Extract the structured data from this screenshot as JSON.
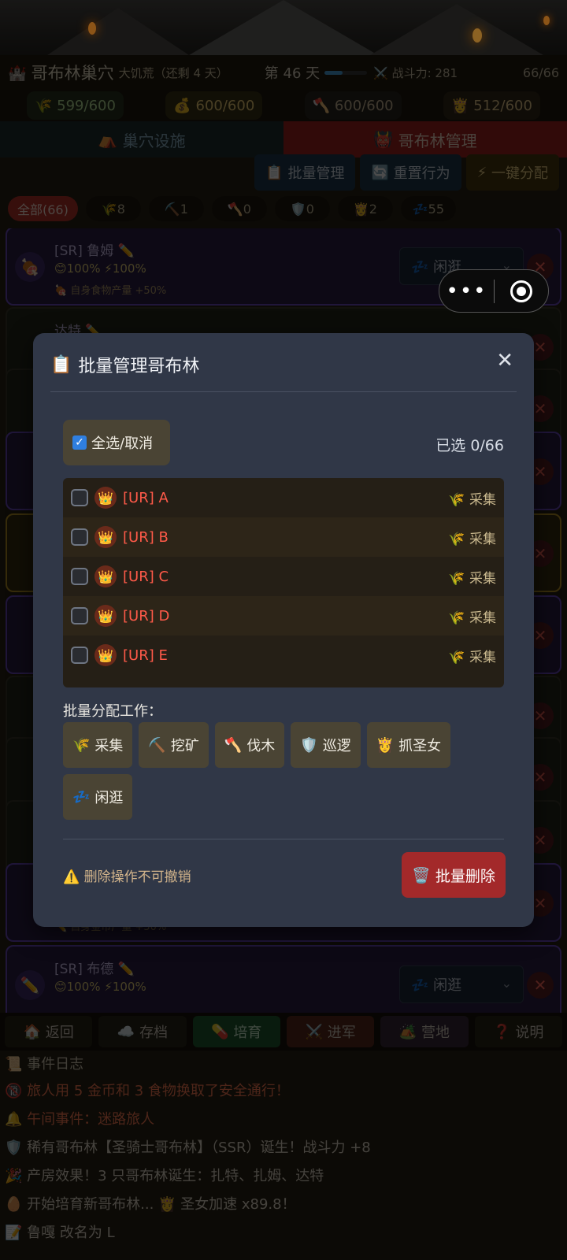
{
  "header": {
    "title": "哥布林巢穴",
    "event": "大饥荒（还剩 4 天）",
    "day": "第 46 天",
    "day_progress": 0.42,
    "power": "战斗力: 281",
    "population": "66/66"
  },
  "resources": [
    {
      "icon": "🌾",
      "value": "599/600"
    },
    {
      "icon": "💰",
      "value": "600/600"
    },
    {
      "icon": "🪓",
      "value": "600/600"
    },
    {
      "icon": "👸",
      "value": "512/600"
    }
  ],
  "tabs": [
    {
      "icon": "⛺",
      "label": "巢穴设施"
    },
    {
      "icon": "👹",
      "label": "哥布林管理"
    }
  ],
  "actions": [
    {
      "icon": "📋",
      "label": "批量管理"
    },
    {
      "icon": "🔄",
      "label": "重置行为"
    },
    {
      "icon": "⚡",
      "label": "一键分配"
    }
  ],
  "filters": [
    {
      "label": "全部(66)"
    },
    {
      "label": "🌾8"
    },
    {
      "label": "⛏️1"
    },
    {
      "label": "🪓0"
    },
    {
      "label": "🛡️0"
    },
    {
      "label": "👸2"
    },
    {
      "label": "💤55"
    }
  ],
  "cards": [
    {
      "name": "[SR] 鲁姆 ✏️",
      "stats": "😊100% ⚡100%",
      "bonus": "🍖 自身食物产量 +50%",
      "job": "💤 闲逛",
      "avatar": "🍖"
    },
    {
      "name": "[SR] 布德 ✏️",
      "stats": "😊100% ⚡100%",
      "bonus": "",
      "job": "💤 闲逛",
      "avatar": "✏️"
    }
  ],
  "background_partial": {
    "card2_name": "达特 ✏️",
    "card_bonus_gold": "✏️ 自身金币产量 +50%"
  },
  "bottom_nav": [
    {
      "icon": "🏠",
      "label": "返回"
    },
    {
      "icon": "☁️",
      "label": "存档"
    },
    {
      "icon": "💊",
      "label": "培育"
    },
    {
      "icon": "⚔️",
      "label": "进军"
    },
    {
      "icon": "🏕️",
      "label": "营地"
    },
    {
      "icon": "❓",
      "label": "说明"
    }
  ],
  "log": {
    "title": "📜 事件日志",
    "entries": [
      {
        "text": "🔞 旅人用 5 金币和 3 食物换取了安全通行！",
        "tone": "orange"
      },
      {
        "text": "🔔 午间事件：迷路旅人",
        "tone": "orange"
      },
      {
        "text": "🛡️ 稀有哥布林【圣骑士哥布林】（SSR）诞生！战斗力 +8",
        "tone": "white"
      },
      {
        "text": "🎉 产房效果！3 只哥布林诞生：扎特、扎姆、达特",
        "tone": "white"
      },
      {
        "text": "🥚 开始培育新哥布林... 👸 圣女加速 x89.8！",
        "tone": "white"
      },
      {
        "text": "📝 鲁嘎 改名为 L",
        "tone": "white"
      }
    ]
  },
  "modal": {
    "title": "批量管理哥布林",
    "title_icon": "📋",
    "close": "✕",
    "select_all": "全选/取消",
    "selected_count": "已选 0/66",
    "goblins": [
      {
        "name": "[UR] A",
        "job": "🌾 采集"
      },
      {
        "name": "[UR] B",
        "job": "🌾 采集"
      },
      {
        "name": "[UR] C",
        "job": "🌾 采集"
      },
      {
        "name": "[UR] D",
        "job": "🌾 采集"
      },
      {
        "name": "[UR] E",
        "job": "🌾 采集"
      }
    ],
    "assign_label": "批量分配工作：",
    "jobs": [
      {
        "icon": "🌾",
        "label": "采集"
      },
      {
        "icon": "⛏️",
        "label": "挖矿"
      },
      {
        "icon": "🪓",
        "label": "伐木"
      },
      {
        "icon": "🛡️",
        "label": "巡逻"
      },
      {
        "icon": "👸",
        "label": "抓圣女"
      },
      {
        "icon": "💤",
        "label": "闲逛"
      }
    ],
    "warning": "⚠️ 删除操作不可撤销",
    "delete_label": "批量删除",
    "delete_icon": "🗑️"
  },
  "capsule": {
    "more": "•••"
  },
  "colors": {
    "accent_red": "#a3292a",
    "modal_bg": "#303747",
    "ur_name": "#ff5a49"
  }
}
